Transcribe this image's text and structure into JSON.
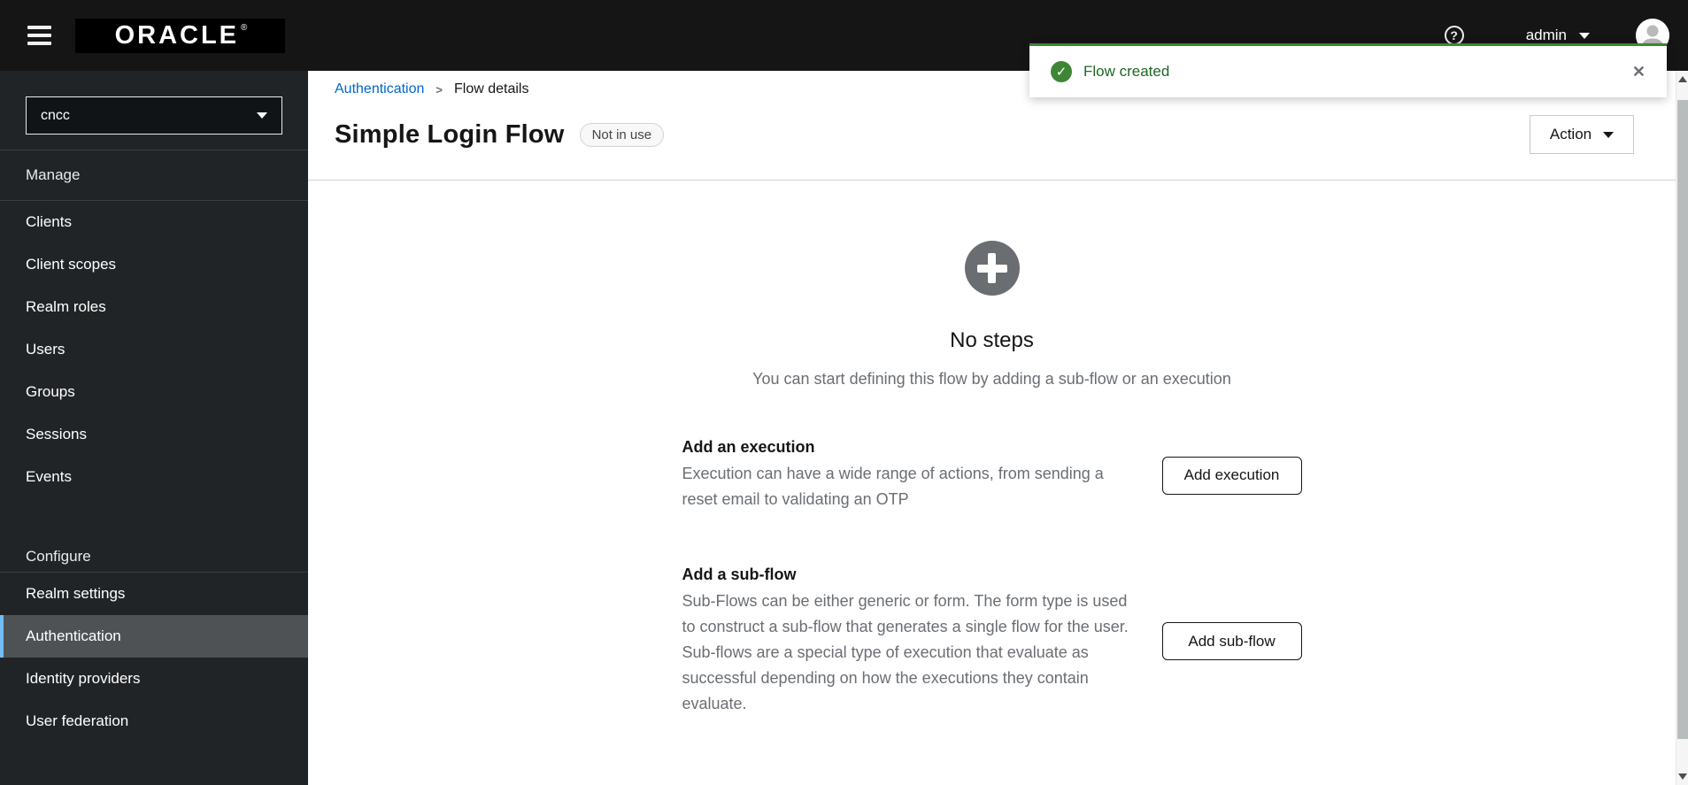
{
  "masthead": {
    "logo": "ORACLE",
    "logo_registered": "®",
    "help_glyph": "?",
    "username": "admin"
  },
  "sidebar": {
    "realm_selector": {
      "value": "cncc"
    },
    "sections": [
      {
        "label": "Manage",
        "items": [
          "Clients",
          "Client scopes",
          "Realm roles",
          "Users",
          "Groups",
          "Sessions",
          "Events"
        ]
      },
      {
        "label": "Configure",
        "items": [
          "Realm settings",
          "Authentication",
          "Identity providers",
          "User federation"
        ]
      }
    ],
    "selected_item": "Authentication"
  },
  "breadcrumb": {
    "parent": "Authentication",
    "separator": ">",
    "current": "Flow details"
  },
  "page": {
    "title": "Simple Login Flow",
    "badge": "Not in use",
    "action_button": "Action"
  },
  "empty_state": {
    "title": "No steps",
    "description": "You can start defining this flow by adding a sub-flow or an execution",
    "options": [
      {
        "heading": "Add an execution",
        "description": "Execution can have a wide range of actions, from sending a reset email to validating an OTP",
        "button": "Add execution"
      },
      {
        "heading": "Add a sub-flow",
        "description": "Sub-Flows can be either generic or form. The form type is used to construct a sub-flow that generates a single flow for the user. Sub-flows are a special type of execution that evaluate as successful depending on how the executions they contain evaluate.",
        "button": "Add sub-flow"
      }
    ]
  },
  "toast": {
    "message": "Flow created",
    "check_glyph": "✓",
    "close_glyph": "✕"
  },
  "colors": {
    "success_green": "#3e8635",
    "toast_text_green": "#1e6823",
    "nav_selected_accent": "#73bcf7",
    "link_blue": "#0066cc",
    "masthead_bg": "#151515",
    "sidebar_bg": "#212427"
  }
}
